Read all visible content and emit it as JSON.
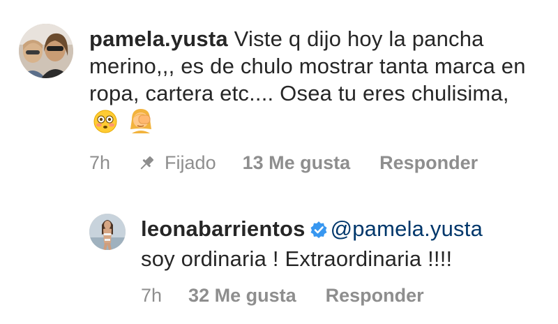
{
  "comments": [
    {
      "username": "pamela.yusta",
      "text": "Viste q dijo hoy la pancha merino,,, es de chulo mostrar tanta marca en ropa, cartera etc.... Osea tu eres chulisima,",
      "emojis": [
        "flushed-face-emoji",
        "facepalm-emoji"
      ],
      "time": "7h",
      "pinned_label": "Fijado",
      "likes": "13 Me gusta",
      "reply_label": "Responder"
    },
    {
      "username": "leonabarrientos",
      "verified": true,
      "mention": "@pamela.yusta",
      "text": "soy ordinaria ! Extraordinaria !!!!",
      "time": "7h",
      "likes": "32 Me gusta",
      "reply_label": "Responder",
      "colors": {
        "verified": "#3897f0",
        "mention": "#00376b"
      }
    }
  ]
}
